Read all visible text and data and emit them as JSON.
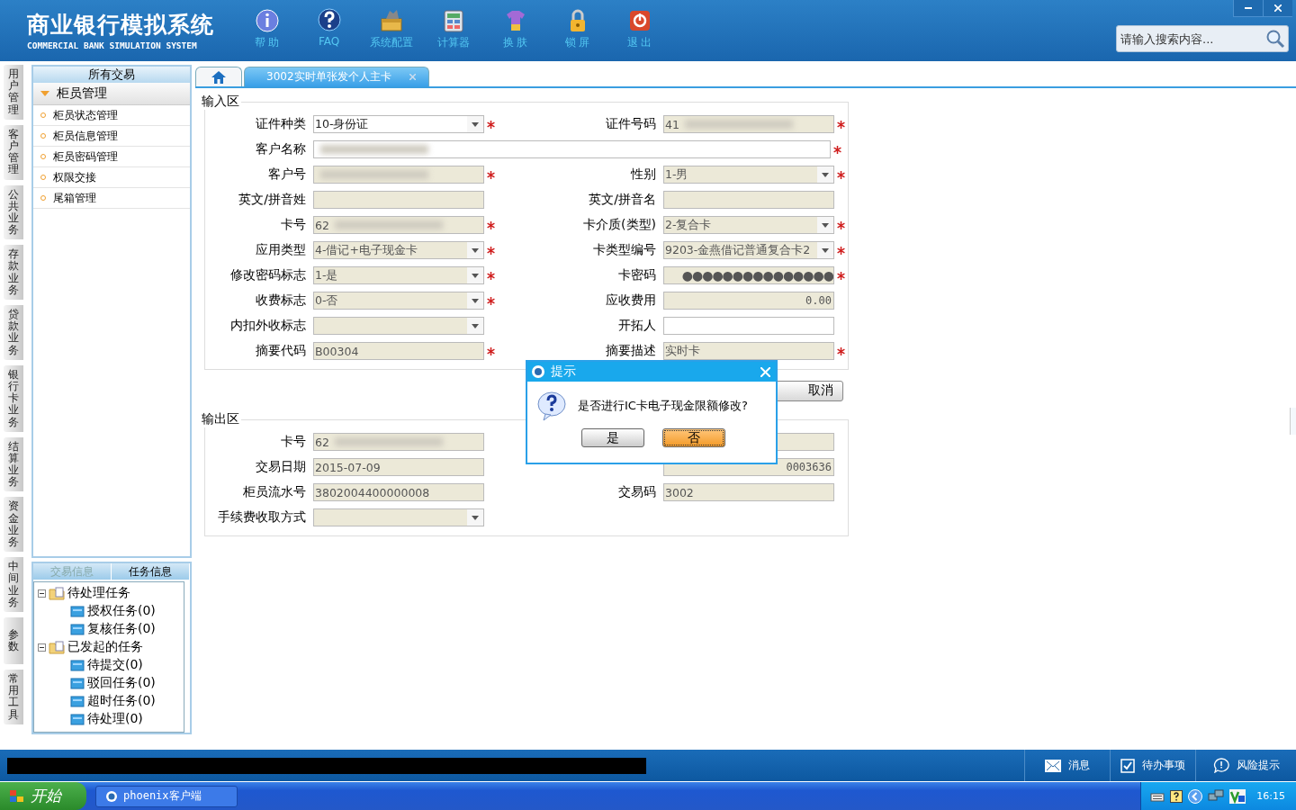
{
  "header": {
    "title": "商业银行模拟系统",
    "subtitle": "COMMERCIAL BANK SIMULATION SYSTEM",
    "search": {
      "placeholder": "请输入搜索内容..."
    }
  },
  "toolbar": [
    {
      "label": "帮 助",
      "kind": "info"
    },
    {
      "label": "FAQ",
      "kind": "faq"
    },
    {
      "label": "系统配置",
      "kind": "toolbox"
    },
    {
      "label": "计算器",
      "kind": "calc"
    },
    {
      "label": "换 肤",
      "kind": "shirt"
    },
    {
      "label": "锁 屏",
      "kind": "lock"
    },
    {
      "label": "退 出",
      "kind": "power"
    }
  ],
  "side_tabs": [
    "用户管理",
    "客户管理",
    "公共业务",
    "存款业务",
    "贷款业务",
    "银行卡业务",
    "结算业务",
    "资金业务",
    "中间业务",
    "参数",
    "常用工具"
  ],
  "sidebar": {
    "title": "所有交易",
    "group": {
      "label": "柜员管理",
      "expanded": true,
      "items": [
        "柜员状态管理",
        "柜员信息管理",
        "柜员密码管理",
        "权限交接",
        "尾箱管理"
      ]
    },
    "tabs": [
      {
        "label": "交易信息",
        "selected": false
      },
      {
        "label": "任务信息",
        "selected": true
      }
    ],
    "tree": [
      {
        "label": "待处理任务",
        "expanded": true,
        "children": [
          {
            "label": "授权任务(0)"
          },
          {
            "label": "复核任务(0)"
          }
        ]
      },
      {
        "label": "已发起的任务",
        "expanded": true,
        "children": [
          {
            "label": "待提交(0)"
          },
          {
            "label": "驳回任务(0)"
          },
          {
            "label": "超时任务(0)"
          },
          {
            "label": "待处理(0)"
          }
        ]
      }
    ]
  },
  "tabs": [
    {
      "kind": "home",
      "selected": false
    },
    {
      "kind": "page",
      "label": "3002实时单张发个人主卡",
      "selected": true
    }
  ],
  "input_area": {
    "title": "输入区",
    "rows": [
      [
        {
          "label": "证件种类",
          "kind": "select",
          "value": "10-身份证",
          "readonly": false,
          "required": true
        },
        {
          "label": "证件号码",
          "kind": "text",
          "value": "41",
          "blurred": true,
          "readonly": true,
          "required": true
        }
      ],
      [
        {
          "label": "客户名称",
          "kind": "wide",
          "blurred": true,
          "readonly": false,
          "required": true
        }
      ],
      [
        {
          "label": "客户号",
          "kind": "text",
          "blurred": true,
          "readonly": true,
          "required": true
        },
        {
          "label": "性别",
          "kind": "select",
          "value": "1-男",
          "readonly": true,
          "required": true
        }
      ],
      [
        {
          "label": "英文/拼音姓",
          "kind": "text",
          "readonly": true,
          "required": false
        },
        {
          "label": "英文/拼音名",
          "kind": "text",
          "readonly": true,
          "required": false
        }
      ],
      [
        {
          "label": "卡号",
          "kind": "text",
          "value": "62",
          "blurred": true,
          "readonly": true,
          "required": true
        },
        {
          "label": "卡介质(类型)",
          "kind": "select",
          "value": "2-复合卡",
          "readonly": true,
          "required": true
        }
      ],
      [
        {
          "label": "应用类型",
          "kind": "select",
          "value": "4-借记+电子现金卡",
          "readonly": true,
          "required": true
        },
        {
          "label": "卡类型编号",
          "kind": "select",
          "value": "9203-金燕借记普通复合卡2",
          "readonly": true,
          "required": true
        }
      ],
      [
        {
          "label": "修改密码标志",
          "kind": "select",
          "value": "1-是",
          "readonly": true,
          "required": true
        },
        {
          "label": "卡密码",
          "kind": "password",
          "value": "●●●●●●●●●●●●●●●",
          "readonly": true,
          "required": true
        }
      ],
      [
        {
          "label": "收费标志",
          "kind": "select",
          "value": "0-否",
          "readonly": true,
          "required": true
        },
        {
          "label": "应收费用",
          "kind": "amount",
          "value": "0.00",
          "readonly": true,
          "required": false
        }
      ],
      [
        {
          "label": "内扣外收标志",
          "kind": "select",
          "readonly": true,
          "required": false
        },
        {
          "label": "开拓人",
          "kind": "text",
          "readonly": false,
          "required": false
        }
      ],
      [
        {
          "label": "摘要代码",
          "kind": "text",
          "value": "B00304",
          "readonly": true,
          "required": true
        },
        {
          "label": "摘要描述",
          "kind": "text",
          "value": "实时卡",
          "readonly": true,
          "required": true
        }
      ]
    ]
  },
  "cancel_button": "取消",
  "output_area": {
    "title": "输出区",
    "rows": [
      [
        {
          "label": "卡号",
          "kind": "text",
          "value": "62",
          "blurred": true,
          "readonly": true,
          "required": false
        },
        {
          "kind": "text",
          "readonly": true,
          "required": false
        }
      ],
      [
        {
          "label": "交易日期",
          "kind": "text",
          "value": "2015-07-09",
          "readonly": true,
          "required": false
        },
        {
          "kind": "amount",
          "value": "0003636",
          "readonly": true,
          "required": false
        }
      ],
      [
        {
          "label": "柜员流水号",
          "kind": "text",
          "value": "3802004400000008",
          "readonly": true,
          "required": false
        },
        {
          "label": "交易码",
          "kind": "text",
          "value": "3002",
          "readonly": true,
          "required": false
        }
      ],
      [
        {
          "label": "手续费收取方式",
          "kind": "select",
          "readonly": true,
          "required": false
        }
      ]
    ]
  },
  "dialog": {
    "title": "提示",
    "message": "是否进行IC卡电子现金限额修改?",
    "buttons": [
      {
        "label": "是",
        "selected": false
      },
      {
        "label": "否",
        "selected": true
      }
    ]
  },
  "status_bar": [
    {
      "label": "消息",
      "kind": "mail"
    },
    {
      "label": "待办事项",
      "kind": "check"
    },
    {
      "label": "风险提示",
      "kind": "bubble"
    }
  ],
  "taskbar": {
    "start": "开始",
    "task": "phoenix客户端",
    "clock": "16:15"
  }
}
